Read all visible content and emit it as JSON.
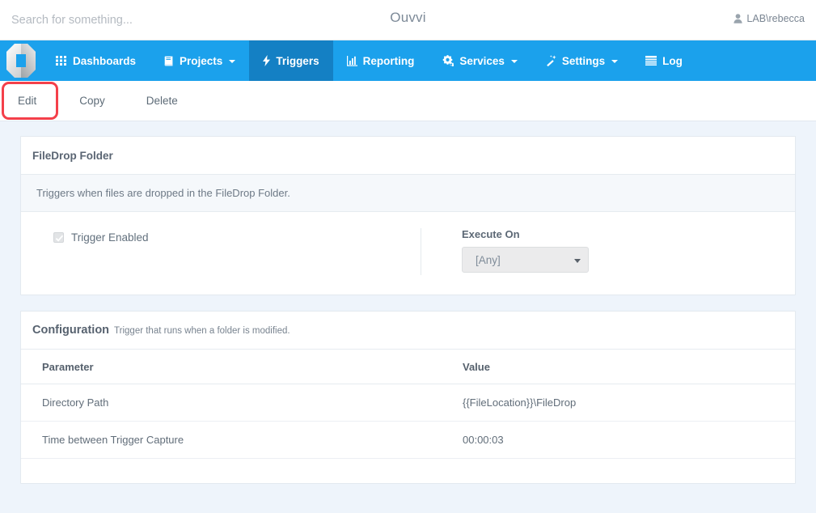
{
  "topbar": {
    "search_placeholder": "Search for something...",
    "search_value": "",
    "app_title": "Ouvvi",
    "user_label": "LAB\\rebecca",
    "user_icon": "user-icon"
  },
  "nav": {
    "logo_icon": "ouvvi-logo-icon",
    "items": [
      {
        "label": "Dashboards",
        "icon": "grid-icon",
        "caret": false,
        "active": false
      },
      {
        "label": "Projects",
        "icon": "book-icon",
        "caret": true,
        "active": false
      },
      {
        "label": "Triggers",
        "icon": "bolt-icon",
        "caret": false,
        "active": true
      },
      {
        "label": "Reporting",
        "icon": "bar-chart-icon",
        "caret": false,
        "active": false
      },
      {
        "label": "Services",
        "icon": "cogs-icon",
        "caret": true,
        "active": false
      },
      {
        "label": "Settings",
        "icon": "magic-wand-icon",
        "caret": true,
        "active": false
      },
      {
        "label": "Log",
        "icon": "list-icon",
        "caret": false,
        "active": false
      }
    ]
  },
  "actionbar": {
    "edit_label": "Edit",
    "copy_label": "Copy",
    "delete_label": "Delete",
    "highlight_color": "#f4404a"
  },
  "trigger_panel": {
    "title": "FileDrop Folder",
    "description": "Triggers when files are dropped in the FileDrop Folder.",
    "enabled_label": "Trigger Enabled",
    "enabled_checked": true,
    "execute_on_label": "Execute On",
    "execute_on_value": "[Any]"
  },
  "config_panel": {
    "title": "Configuration",
    "subtitle": "Trigger that runs when a folder is modified.",
    "columns": [
      "Parameter",
      "Value"
    ],
    "rows": [
      {
        "parameter": "Directory Path",
        "value": "{{FileLocation}}\\FileDrop"
      },
      {
        "parameter": "Time between Trigger Capture",
        "value": "00:00:03"
      }
    ]
  },
  "colors": {
    "nav_blue": "#1ba1ec",
    "nav_active_blue": "#1480c4",
    "page_bg": "#eef4fb",
    "highlight_red": "#f4404a"
  }
}
